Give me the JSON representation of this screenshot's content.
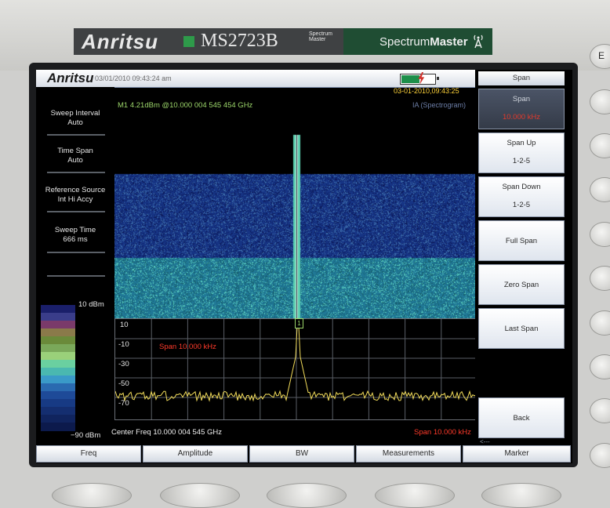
{
  "device": {
    "brand": "Anritsu",
    "model": "MS2723B",
    "model_sub": "Spectrum Master",
    "product_left": "Spectrum",
    "product_right": "Master"
  },
  "statusbar": {
    "logo": "Anritsu",
    "datetime": "03/01/2010 09:43:24 am",
    "battery_level": 0.55
  },
  "trace_header": {
    "marker": "M1 4.21dBm @10.000 004 545 454 GHz",
    "timestamp": "03-01-2010,09:43:25",
    "mode": "IA (Spectrogram)"
  },
  "left_panel": [
    {
      "label": "Sweep Interval",
      "value": "Auto"
    },
    {
      "label": "Time Span",
      "value": "Auto"
    },
    {
      "label": "Reference Source",
      "value": "Int Hi Accy"
    },
    {
      "label": "Sweep Time",
      "value": "666 ms"
    }
  ],
  "colorbar": {
    "top_label": "10 dBm",
    "bottom_label": "−90 dBm",
    "colors": [
      "#1a1f6a",
      "#3a3d8a",
      "#7a3a6a",
      "#8a7a4a",
      "#6a8a3a",
      "#7aa85a",
      "#9ad07a",
      "#6ad0a0",
      "#4ab8b0",
      "#3a9ac8",
      "#2a6ab0",
      "#1e4a98",
      "#173a84",
      "#142e70",
      "#10245e",
      "#0c1a4c"
    ]
  },
  "graph": {
    "y_ticks": [
      "10",
      "-10",
      "-30",
      "-50",
      "-70"
    ],
    "span_label": "Span 10.000 kHz",
    "marker_tag": "1"
  },
  "footer": {
    "center_freq": "Center Freq 10.000 004 545 GHz",
    "span": "Span 10.000 kHz",
    "arrows": "<---"
  },
  "softkeys": {
    "header": "Span",
    "buttons": [
      {
        "line1": "Span",
        "line2": "10.000 kHz",
        "active": true
      },
      {
        "line1": "Span Up",
        "line2": "1-2-5"
      },
      {
        "line1": "Span Down",
        "line2": "1-2-5"
      },
      {
        "center": "Full Span"
      },
      {
        "center": "Zero Span"
      },
      {
        "center": "Last Span"
      },
      {
        "center": "Back"
      }
    ]
  },
  "tabs": [
    "Freq",
    "Amplitude",
    "BW",
    "Measurements",
    "Marker"
  ],
  "side_button_label": "E"
}
